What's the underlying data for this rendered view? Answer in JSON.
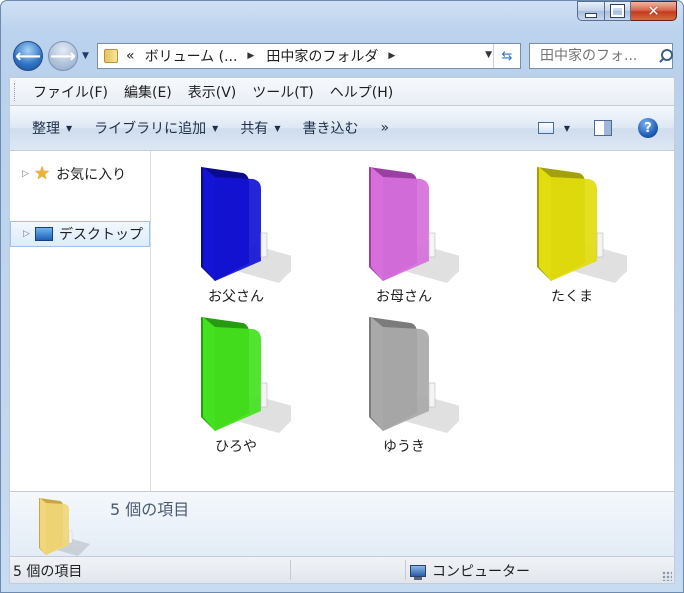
{
  "window": {
    "caption_buttons": {
      "minimize": "minimize-icon",
      "maximize": "maximize-icon",
      "close": "close-icon"
    }
  },
  "nav": {
    "back_icon": "back-arrow-icon",
    "forward_icon": "forward-arrow-icon",
    "address": {
      "overflow": "«",
      "crumbs": [
        "ボリューム (...",
        "田中家のフォルダ"
      ]
    },
    "search": {
      "placeholder": "田中家のフォ..."
    }
  },
  "menubar": {
    "items": [
      "ファイル(F)",
      "編集(E)",
      "表示(V)",
      "ツール(T)",
      "ヘルプ(H)"
    ]
  },
  "commandbar": {
    "items": [
      "整理",
      "ライブラリに追加",
      "共有",
      "書き込む",
      "»"
    ]
  },
  "navpane": {
    "items": [
      {
        "label": "お気に入り",
        "icon": "star-icon",
        "selected": false
      },
      {
        "label": "デスクトップ",
        "icon": "desktop-icon",
        "selected": true
      }
    ]
  },
  "content": {
    "folders": [
      {
        "name": "お父さん",
        "color": "#1414d6",
        "shade": "#0a0a8a"
      },
      {
        "name": "お母さん",
        "color": "#d66fdc",
        "shade": "#9c3fa3"
      },
      {
        "name": "たくま",
        "color": "#e2dd0e",
        "shade": "#a3a00a"
      },
      {
        "name": "ひろや",
        "color": "#44e21e",
        "shade": "#279c10"
      },
      {
        "name": "ゆうき",
        "color": "#a9a9a9",
        "shade": "#7b7b7b"
      }
    ]
  },
  "details": {
    "count_text": "5 個の項目",
    "folder_color": "#f1d77a",
    "folder_shade": "#c9a640"
  },
  "statusbar": {
    "left_text": "5 個の項目",
    "right_text": "コンピューター"
  }
}
